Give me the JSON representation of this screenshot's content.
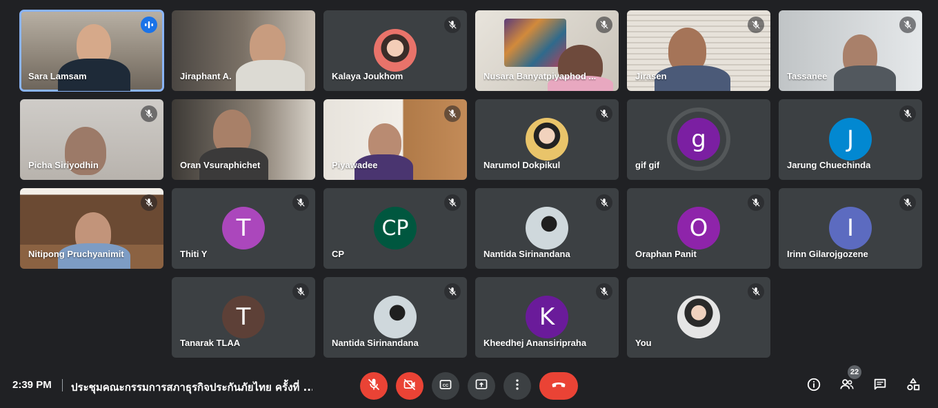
{
  "meeting": {
    "time": "2:39 PM",
    "title": "ประชุมคณะกรรมการสภาธุรกิจประกันภัยไทย ครั้งที่ ..."
  },
  "participants_count": "22",
  "tiles": [
    {
      "name": "Sara Lamsam",
      "kind": "video",
      "mic": "speaking"
    },
    {
      "name": "Jiraphant A.",
      "kind": "video",
      "mic": "none"
    },
    {
      "name": "Kalaya Joukhom",
      "kind": "photo",
      "mic": "muted"
    },
    {
      "name": "Nusara Banyatpiyaphod ...",
      "kind": "video",
      "mic": "muted"
    },
    {
      "name": "Jirasen",
      "kind": "video",
      "mic": "muted"
    },
    {
      "name": "Tassanee",
      "kind": "video",
      "mic": "muted"
    },
    {
      "name": "Picha Siriyodhin",
      "kind": "video",
      "mic": "muted"
    },
    {
      "name": "Oran Vsuraphichet",
      "kind": "video",
      "mic": "none"
    },
    {
      "name": "Piyawadee",
      "kind": "video",
      "mic": "muted"
    },
    {
      "name": "Narumol Dokpikul",
      "kind": "photo",
      "mic": "muted"
    },
    {
      "name": "gif gif",
      "kind": "letter",
      "letter": "g",
      "color": "#7b1fa2",
      "mic": "none"
    },
    {
      "name": "Jarung Chuechinda",
      "kind": "letter",
      "letter": "J",
      "color": "#0288d1",
      "mic": "muted"
    },
    {
      "name": "Nitipong Pruchyanimit",
      "kind": "video",
      "mic": "muted"
    },
    {
      "name": "Thiti Y",
      "kind": "letter",
      "letter": "T",
      "color": "#ab47bc",
      "mic": "muted"
    },
    {
      "name": "CP",
      "kind": "letter",
      "letter": "CP",
      "color": "#00573f",
      "mic": "muted"
    },
    {
      "name": "Nantida Sirinandana",
      "kind": "photo",
      "mic": "muted"
    },
    {
      "name": "Oraphan Panit",
      "kind": "letter",
      "letter": "O",
      "color": "#8e24aa",
      "mic": "muted"
    },
    {
      "name": "Irinn Gilarojgozene",
      "kind": "letter",
      "letter": "I",
      "color": "#5c6bc0",
      "mic": "muted"
    },
    {
      "name": "Tanarak TLAA",
      "kind": "letter",
      "letter": "T",
      "color": "#5d4037",
      "mic": "muted"
    },
    {
      "name": "Nantida Sirinandana",
      "kind": "photo",
      "mic": "muted"
    },
    {
      "name": "Kheedhej Anansiripraha",
      "kind": "letter",
      "letter": "K",
      "color": "#6a1b9a",
      "mic": "muted"
    },
    {
      "name": "You",
      "kind": "photo",
      "mic": "muted"
    }
  ],
  "controls": {
    "center": [
      "mic-off-icon",
      "camera-off-icon",
      "captions-icon",
      "present-screen-icon",
      "more-options-icon",
      "end-call-icon"
    ],
    "right": [
      "info-icon",
      "people-icon",
      "chat-icon",
      "activities-icon"
    ]
  },
  "colors": {
    "background": "#202124",
    "tile": "#3c4043",
    "red": "#ea4335",
    "speaking": "#8ab4f8"
  }
}
